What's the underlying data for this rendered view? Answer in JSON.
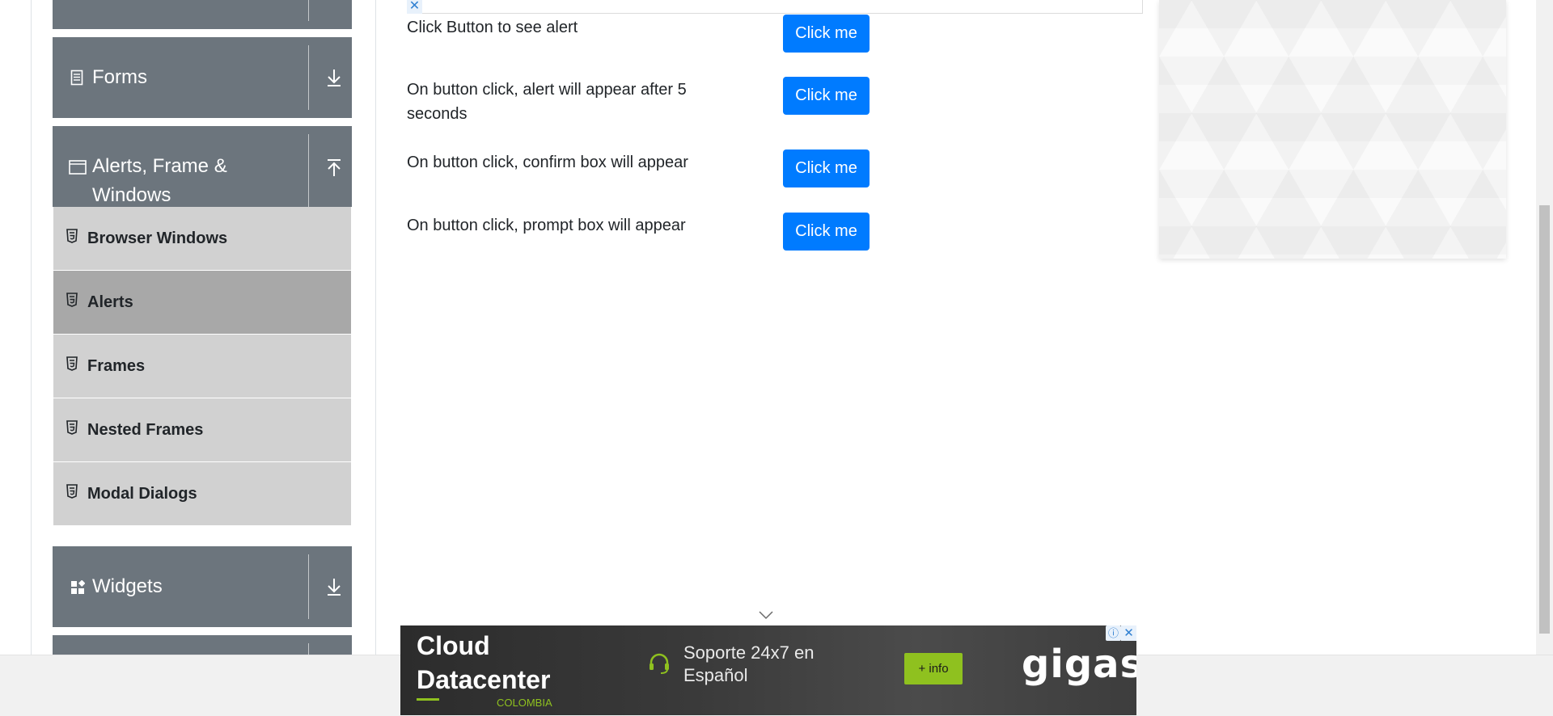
{
  "sidebar": {
    "groups": [
      {
        "label": ""
      },
      {
        "label": "Forms",
        "icon": "form-icon",
        "arrow": "download-arrow-icon"
      },
      {
        "label": "Alerts, Frame &",
        "label_line2": "Windows",
        "icon": "window-icon",
        "arrow": "upload-arrow-icon"
      },
      {
        "label": "Widgets",
        "icon": "widgets-icon",
        "arrow": "download-arrow-icon"
      },
      {
        "label": ""
      }
    ],
    "items": [
      {
        "label": "Browser Windows",
        "active": false
      },
      {
        "label": "Alerts",
        "active": true
      },
      {
        "label": "Frames",
        "active": false
      },
      {
        "label": "Nested Frames",
        "active": false
      },
      {
        "label": "Modal Dialogs",
        "active": false
      }
    ]
  },
  "main": {
    "rows": [
      {
        "text": "Click Button to see alert",
        "button": "Click me"
      },
      {
        "text": "On button click, alert will appear after 5 seconds",
        "button": "Click me"
      },
      {
        "text": "On button click, confirm box will appear",
        "button": "Click me"
      },
      {
        "text": "On button click, prompt box will appear",
        "button": "Click me"
      }
    ],
    "ad_close": "✕"
  },
  "ad": {
    "title": "Cloud Datacenter",
    "sub": "COLOMBIA",
    "support": "Soporte 24x7 en Español",
    "info_button": "+ info",
    "brand": "gigas",
    "info_icon": "ⓘ",
    "close_icon": "✕"
  },
  "colors": {
    "group_bg": "#6c757d",
    "item_bg": "#d1d1d1",
    "item_active_bg": "#a8a8a8",
    "button": "#007bff",
    "ad_accent": "#8fc11f"
  }
}
